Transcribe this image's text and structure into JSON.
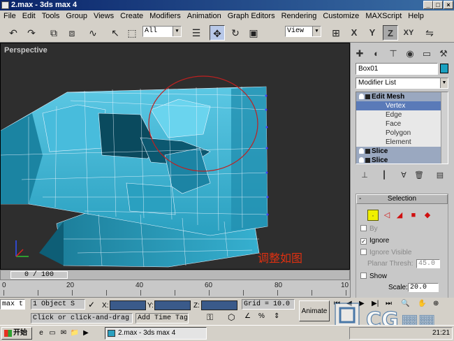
{
  "window": {
    "title": "2.max - 3ds max 4",
    "buttons": {
      "minimize": "_",
      "maximize": "□",
      "close": "×"
    }
  },
  "menu": [
    "File",
    "Edit",
    "Tools",
    "Group",
    "Views",
    "Create",
    "Modifiers",
    "Animation",
    "Graph Editors",
    "Rendering",
    "Customize",
    "MAXScript",
    "Help"
  ],
  "toolbar": {
    "selection_filter": "All",
    "coord_system": "View",
    "axis_constraints": [
      "X",
      "Y",
      "Z",
      "XY"
    ],
    "icons": [
      "undo-icon",
      "redo-icon",
      "select-link-icon",
      "unlink-icon",
      "bind-spacewarp-icon",
      "select-icon",
      "select-region-icon",
      "select-by-name-icon",
      "move-icon",
      "rotate-icon",
      "scale-icon",
      "pivot-icon",
      "mirror-icon"
    ]
  },
  "viewport": {
    "label": "Perspective",
    "annotation": "调整如图",
    "colors": {
      "background": "#2e2e2e",
      "mesh": "#2ea8c8",
      "mesh_dark": "#106a84",
      "wire": "#e8f4ff",
      "circle": "#c02020"
    }
  },
  "command_panel": {
    "object_name": "Box01",
    "object_color": "#1aa0c0",
    "modifier_list": "Modifier List",
    "stack": [
      {
        "label": "Edit Mesh",
        "level": 0,
        "header": true
      },
      {
        "label": "Vertex",
        "level": 1,
        "selected": true
      },
      {
        "label": "Edge",
        "level": 1
      },
      {
        "label": "Face",
        "level": 1
      },
      {
        "label": "Polygon",
        "level": 1
      },
      {
        "label": "Element",
        "level": 1
      },
      {
        "label": "Slice",
        "level": 0,
        "header": true
      },
      {
        "label": "Slice",
        "level": 0,
        "header": true
      }
    ],
    "selection": {
      "title": "Selection",
      "by_label": "By",
      "ignore_backfacing": "Ignore",
      "ignore_visible": "Ignore Visible",
      "planar_thresh_label": "Planar Thresh:",
      "planar_thresh_value": "45.0",
      "show_label": "Show",
      "scale_label": "Scale:",
      "scale_value": "20.0"
    }
  },
  "timeline": {
    "frame_display": "0 / 100",
    "ticks": [
      "0",
      "20",
      "40",
      "60",
      "80",
      "10"
    ]
  },
  "status": {
    "max_script": "max t",
    "selected": "1 Object S",
    "prompt": "Click or click-and-drag t",
    "x_label": "X:",
    "y_label": "Y:",
    "z_label": "Z:",
    "grid": "Grid = 10.0",
    "add_time_tag": "Add Time Tag",
    "animate": "Animate"
  },
  "taskbar": {
    "start": "开始",
    "task": "2.max - 3ds max 4",
    "clock": "21:21"
  },
  "watermark": "CG"
}
